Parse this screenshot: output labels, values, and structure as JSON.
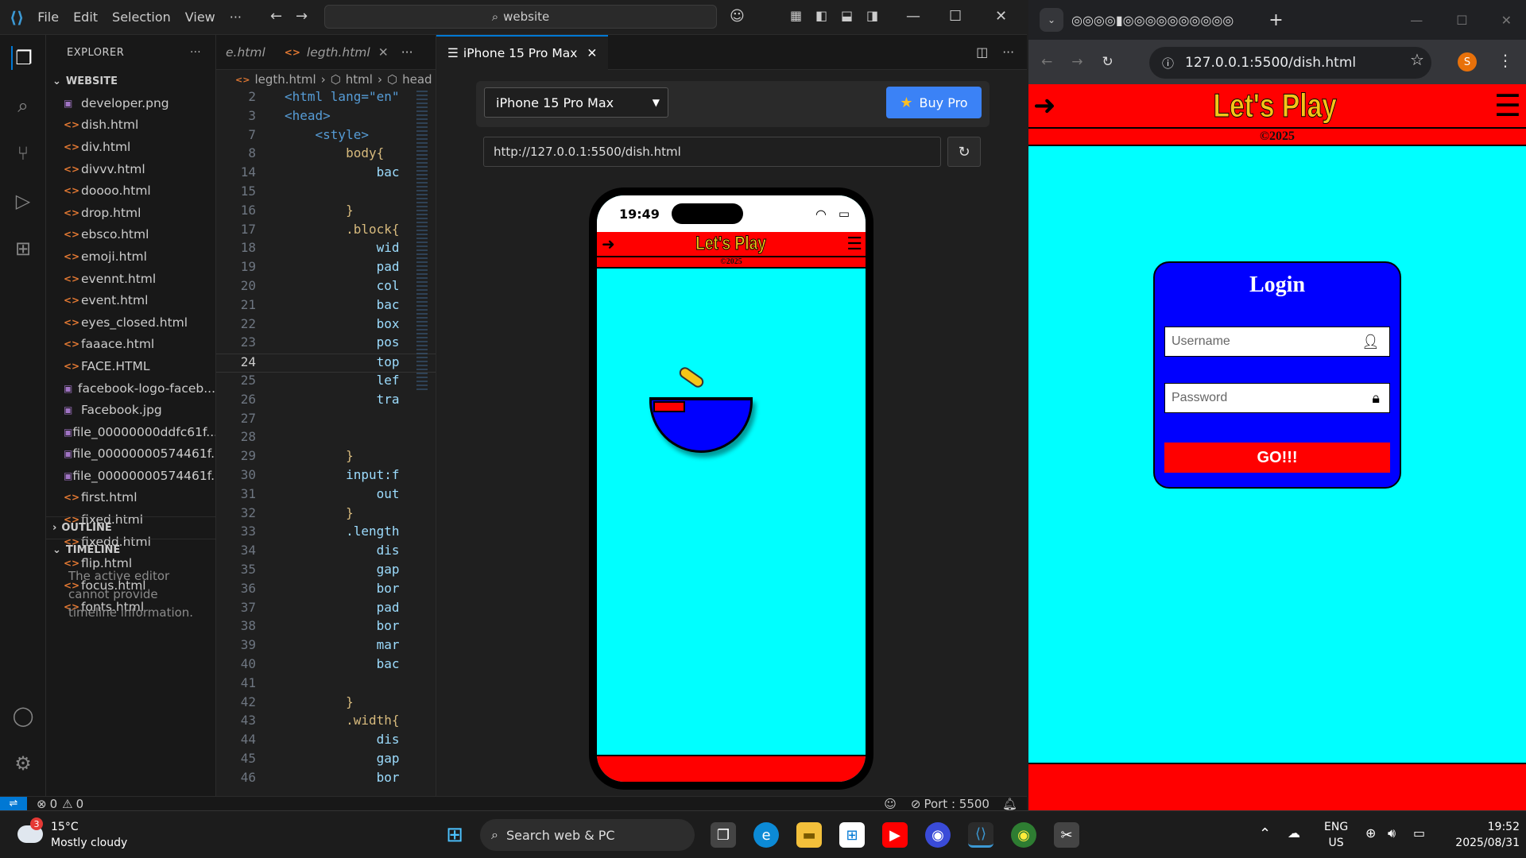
{
  "vscode": {
    "menu": [
      "File",
      "Edit",
      "Selection",
      "View",
      "···"
    ],
    "search": "website",
    "explorer": {
      "title": "EXPLORER",
      "folder": "WEBSITE",
      "files": [
        {
          "name": "developer.png",
          "type": "img"
        },
        {
          "name": "dish.html",
          "type": "html"
        },
        {
          "name": "div.html",
          "type": "html"
        },
        {
          "name": "divvv.html",
          "type": "html"
        },
        {
          "name": "doooo.html",
          "type": "html"
        },
        {
          "name": "drop.html",
          "type": "html"
        },
        {
          "name": "ebsco.html",
          "type": "html"
        },
        {
          "name": "emoji.html",
          "type": "html"
        },
        {
          "name": "evennt.html",
          "type": "html"
        },
        {
          "name": "event.html",
          "type": "html"
        },
        {
          "name": "eyes_closed.html",
          "type": "html"
        },
        {
          "name": "faaace.html",
          "type": "html"
        },
        {
          "name": "FACE.HTML",
          "type": "html"
        },
        {
          "name": "facebook-logo-faceb...",
          "type": "img"
        },
        {
          "name": "Facebook.jpg",
          "type": "img"
        },
        {
          "name": "file_00000000ddfc61f...",
          "type": "img"
        },
        {
          "name": "file_00000000574461f...",
          "type": "img"
        },
        {
          "name": "file_00000000574461f...",
          "type": "img"
        },
        {
          "name": "first.html",
          "type": "html"
        },
        {
          "name": "fixed.html",
          "type": "html"
        },
        {
          "name": "fixedd.html",
          "type": "html"
        },
        {
          "name": "flip.html",
          "type": "html"
        },
        {
          "name": "focus.html",
          "type": "html"
        },
        {
          "name": "fonts.html",
          "type": "html"
        }
      ],
      "outline": "OUTLINE",
      "timeline": "TIMELINE",
      "timeline_msg": "The active editor cannot provide timeline information."
    },
    "editor": {
      "tab_prev": "e.html",
      "tab_active": "legth.html",
      "breadcrumb": [
        "legth.html",
        "html",
        "head"
      ],
      "lines": [
        {
          "n": "2",
          "t": "<html lang=\"en\""
        },
        {
          "n": "3",
          "t": "<head>"
        },
        {
          "n": "7",
          "t": "    <style>"
        },
        {
          "n": "8",
          "t": "        body{"
        },
        {
          "n": "14",
          "t": "            bac"
        },
        {
          "n": "15",
          "t": ""
        },
        {
          "n": "16",
          "t": "        }"
        },
        {
          "n": "17",
          "t": "        .block{"
        },
        {
          "n": "18",
          "t": "            wid"
        },
        {
          "n": "19",
          "t": "            pad"
        },
        {
          "n": "20",
          "t": "            col"
        },
        {
          "n": "21",
          "t": "            bac"
        },
        {
          "n": "22",
          "t": "            box"
        },
        {
          "n": "23",
          "t": "            pos"
        },
        {
          "n": "24",
          "t": "            top"
        },
        {
          "n": "25",
          "t": "            lef"
        },
        {
          "n": "26",
          "t": "            tra"
        },
        {
          "n": "27",
          "t": ""
        },
        {
          "n": "28",
          "t": ""
        },
        {
          "n": "29",
          "t": "        }"
        },
        {
          "n": "30",
          "t": "        input:f"
        },
        {
          "n": "31",
          "t": "            out"
        },
        {
          "n": "32",
          "t": "        }"
        },
        {
          "n": "33",
          "t": "        .length"
        },
        {
          "n": "34",
          "t": "            dis"
        },
        {
          "n": "35",
          "t": "            gap"
        },
        {
          "n": "36",
          "t": "            bor"
        },
        {
          "n": "37",
          "t": "            pad"
        },
        {
          "n": "38",
          "t": "            bor"
        },
        {
          "n": "39",
          "t": "            mar"
        },
        {
          "n": "40",
          "t": "            bac"
        },
        {
          "n": "41",
          "t": ""
        },
        {
          "n": "42",
          "t": "        }"
        },
        {
          "n": "43",
          "t": "        .width{"
        },
        {
          "n": "44",
          "t": "            dis"
        },
        {
          "n": "45",
          "t": "            gap"
        },
        {
          "n": "46",
          "t": "            bor"
        }
      ]
    },
    "preview": {
      "tab": "iPhone 15 Pro Max",
      "device": "iPhone 15 Pro Max",
      "buy_pro": "Buy Pro",
      "url": "http://127.0.0.1:5500/dish.html",
      "phone_time": "19:49"
    },
    "status": {
      "errors": "0",
      "warnings": "0",
      "port": "Port : 5500"
    }
  },
  "app": {
    "title": "Let's Play",
    "copyright": "©2025",
    "login_title": "Login",
    "username_placeholder": "Username",
    "password_placeholder": "Password",
    "go": "GO!!!"
  },
  "browser": {
    "address": "127.0.0.1:5500/dish.html",
    "profile": "S"
  },
  "taskbar": {
    "weather_temp": "15°C",
    "weather_desc": "Mostly cloudy",
    "weather_badge": "3",
    "search": "Search web & PC",
    "lang1": "ENG",
    "lang2": "US",
    "time": "19:52",
    "date": "2025/08/31"
  }
}
